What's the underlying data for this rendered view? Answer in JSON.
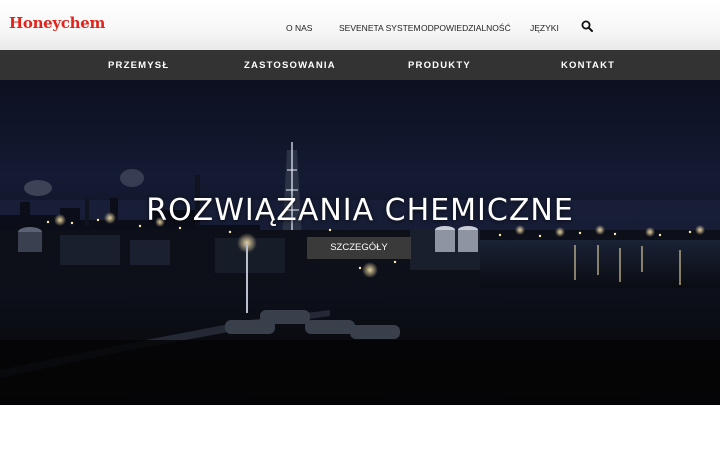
{
  "brand": {
    "logo_text": "Honeychem",
    "accent": "#e2231a"
  },
  "top_nav": {
    "items": [
      {
        "label": "O NAS"
      },
      {
        "label": "SEVENETA SYSTEM"
      },
      {
        "label": "ODPOWIEDZIALNOŚĆ"
      },
      {
        "label": "JĘZYKI"
      }
    ],
    "search_icon": "search-icon"
  },
  "main_nav": {
    "items": [
      {
        "label": "PRZEMYSŁ"
      },
      {
        "label": "ZASTOSOWANIA"
      },
      {
        "label": "PRODUKTY"
      },
      {
        "label": "KONTAKT"
      }
    ],
    "background": "#333333"
  },
  "hero": {
    "title": "ROZWIĄZANIA CHEMICZNE",
    "button_label": "SZCZEGÓŁY"
  }
}
